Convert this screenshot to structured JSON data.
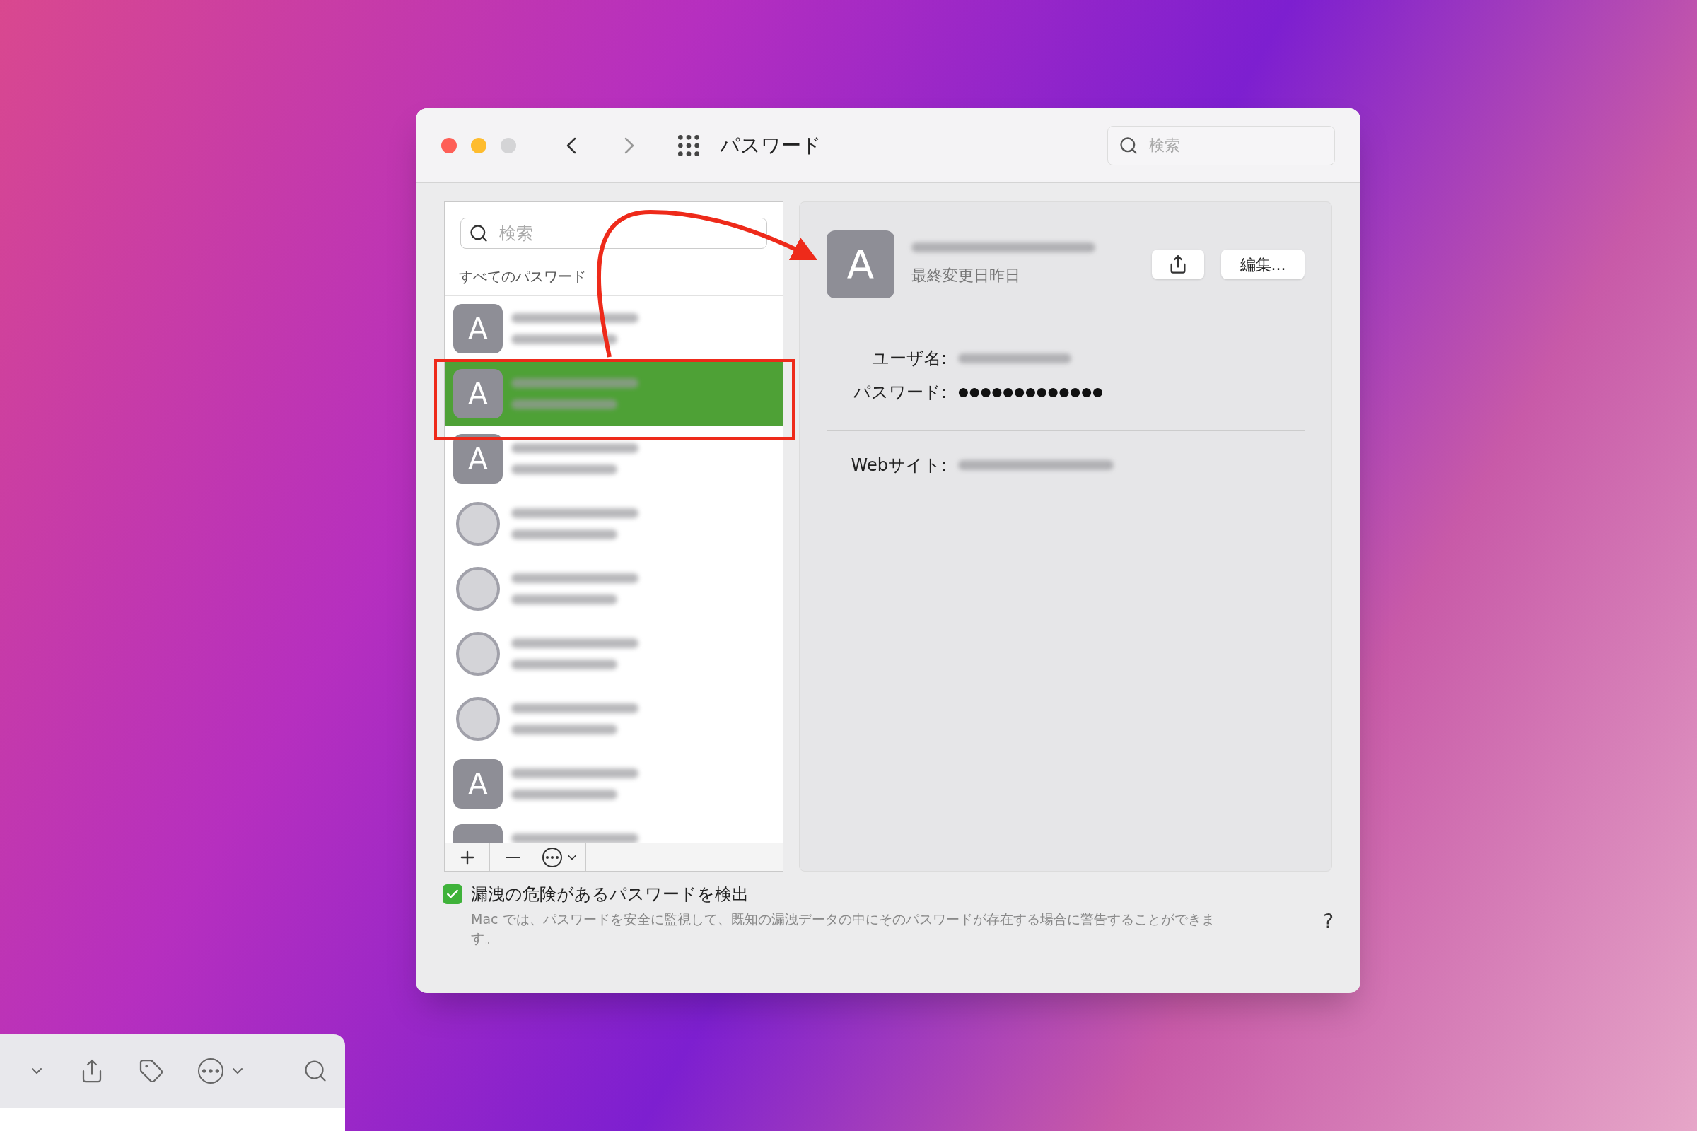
{
  "window": {
    "title": "パスワード",
    "search_placeholder": "検索"
  },
  "sidebar": {
    "search_placeholder": "検索",
    "section": "すべてのパスワード",
    "items": [
      {
        "kind": "letter",
        "letter": "A",
        "selected": false
      },
      {
        "kind": "letter",
        "letter": "A",
        "selected": true
      },
      {
        "kind": "letter",
        "letter": "A",
        "selected": false
      },
      {
        "kind": "logo",
        "selected": false
      },
      {
        "kind": "logo",
        "selected": false
      },
      {
        "kind": "logo",
        "selected": false
      },
      {
        "kind": "logo",
        "selected": false
      },
      {
        "kind": "letter",
        "letter": "A",
        "selected": false
      },
      {
        "kind": "letter",
        "selected": false
      }
    ]
  },
  "detail": {
    "avatar_letter": "A",
    "modified": "最終変更日昨日",
    "edit_button": "編集...",
    "fields": [
      {
        "label": "ユーザ名:",
        "kind": "hidden"
      },
      {
        "label": "パスワード:",
        "kind": "dots",
        "value": "●●●●●●●●●●●●●"
      }
    ],
    "website": {
      "label": "Webサイト:"
    }
  },
  "footer": {
    "checked": true,
    "label": "漏洩の危険があるパスワードを検出",
    "description": "Mac では、パスワードを安全に監視して、既知の漏洩データの中にそのパスワードが存在する場合に警告することができます。",
    "help": "?"
  }
}
